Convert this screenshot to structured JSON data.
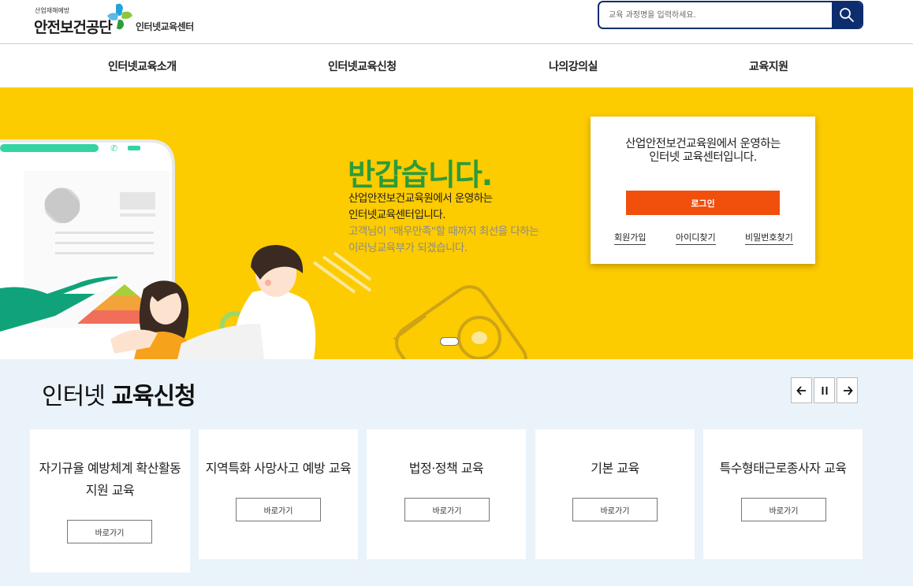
{
  "header": {
    "logo_small": "산업재해예방",
    "logo_main": "안전보건공단",
    "logo_sub": "인터넷교육센터",
    "search_placeholder": "교육 과정명을 입력하세요."
  },
  "nav": {
    "items": [
      {
        "label": "인터넷교육소개"
      },
      {
        "label": "인터넷교육신청"
      },
      {
        "label": "나의강의실"
      },
      {
        "label": "교육지원"
      }
    ]
  },
  "hero": {
    "title": "반갑습니다.",
    "line1": "산업안전보건교육원에서 운영하는",
    "line2": "인터넷교육센터입니다.",
    "line3": "고객님이 \"매우만족\"할 때까지 최선을 다하는",
    "line4": "이러닝교육부가 되겠습니다."
  },
  "login": {
    "message_line1": "산업안전보건교육원에서 운영하는",
    "message_line2": "인터넷 교육센터입니다.",
    "login_button": "로그인",
    "signup": "회원가입",
    "find_id": "아이디찾기",
    "find_pw": "비밀번호찾기"
  },
  "courses": {
    "title_normal": "인터넷 ",
    "title_bold": "교육신청",
    "go_label": "바로가기",
    "cards": [
      {
        "line1": "자기규율 예방체계 확산활동",
        "line2": "지원 교육"
      },
      {
        "line1": "지역특화 사망사고 예방 교육",
        "line2": ""
      },
      {
        "line1": "법정·정책 교육",
        "line2": ""
      },
      {
        "line1": "기본 교육",
        "line2": ""
      },
      {
        "line1": "특수형태근로종사자 교육",
        "line2": ""
      }
    ]
  },
  "colors": {
    "brand_navy": "#0e2d6e",
    "hero_yellow": "#fccb00",
    "hero_title_green": "#2d9b3a",
    "login_orange": "#f04f0c",
    "section_bg": "#eaf3fa"
  }
}
